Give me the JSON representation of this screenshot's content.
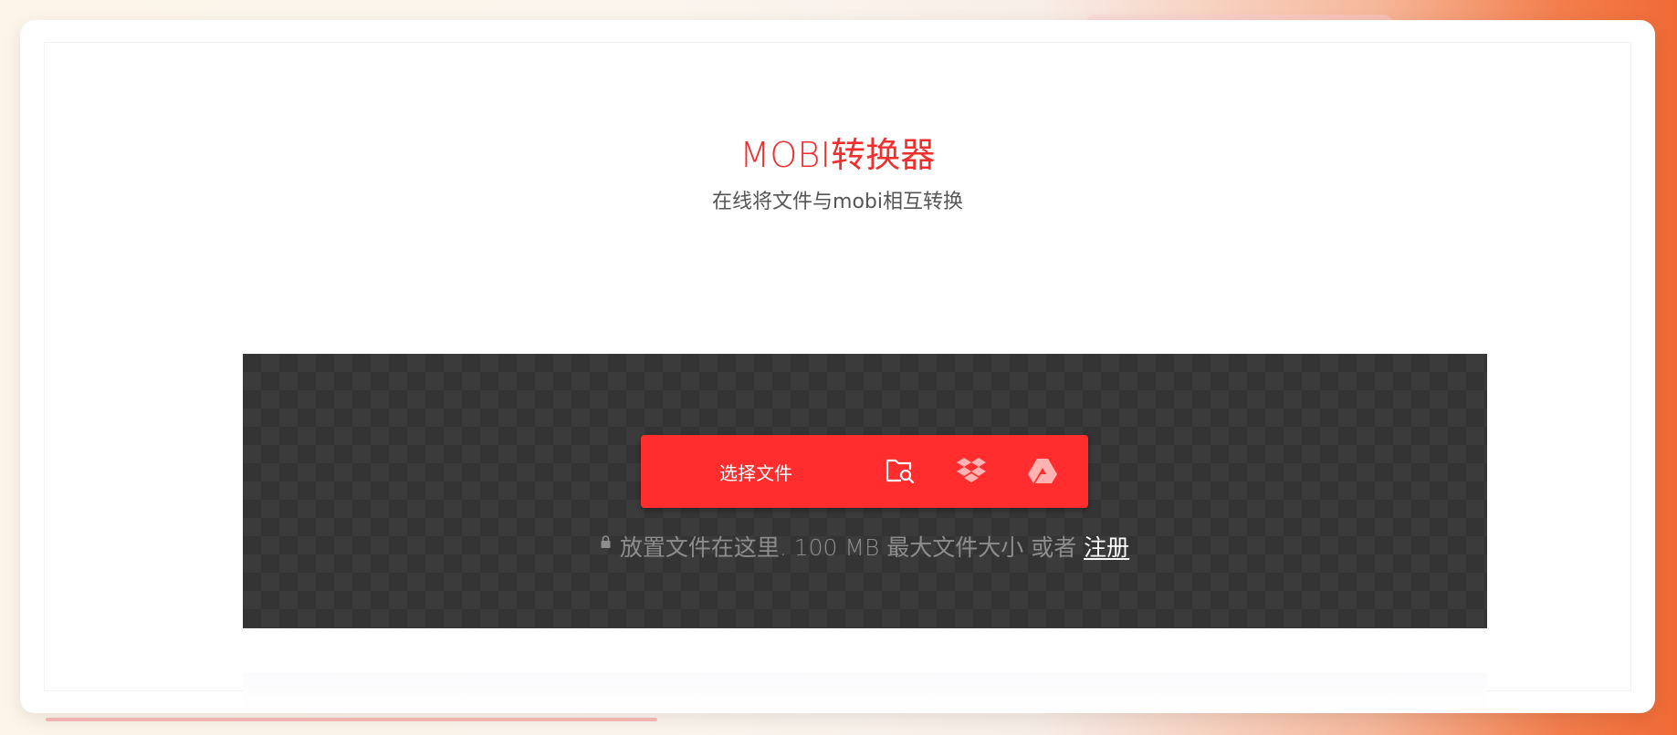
{
  "header": {
    "title": "MOBI转换器",
    "subtitle": "在线将文件与mobi相互转换"
  },
  "upload": {
    "choose_label": "选择文件",
    "sources": [
      {
        "name": "local-file",
        "icon": "folder-search-icon"
      },
      {
        "name": "dropbox",
        "icon": "dropbox-icon"
      },
      {
        "name": "google-drive",
        "icon": "google-drive-icon"
      }
    ],
    "hint_text": "放置文件在这里. 100 MB 最大文件大小 或者",
    "register_label": "注册"
  },
  "colors": {
    "accent": "#ff2d2d",
    "title": "#ef2e2e",
    "dropzone_bg": "#343434"
  }
}
